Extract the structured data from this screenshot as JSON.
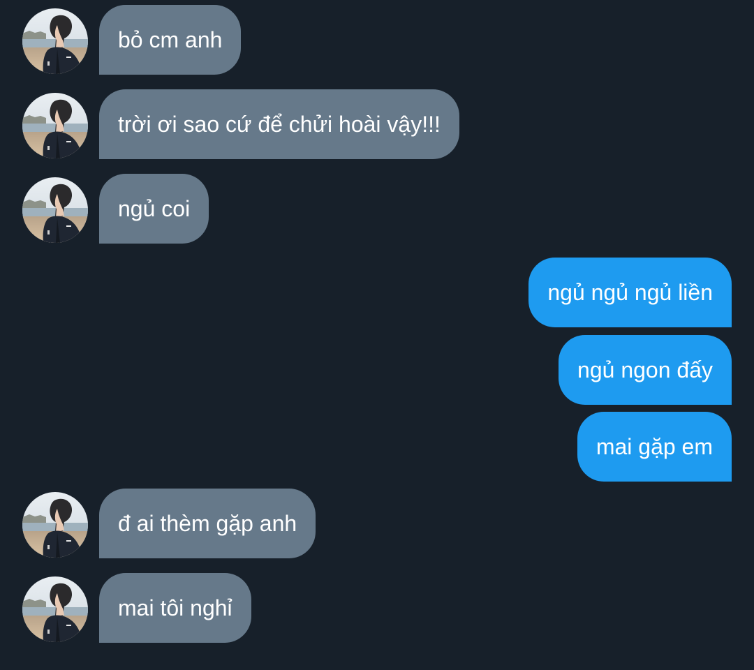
{
  "messages": [
    {
      "direction": "incoming",
      "text": "bỏ cm anh"
    },
    {
      "direction": "incoming",
      "text": "trời ơi sao cứ để chửi hoài vậy!!!"
    },
    {
      "direction": "incoming",
      "text": "ngủ coi"
    },
    {
      "direction": "outgoing",
      "text": "ngủ ngủ ngủ liền"
    },
    {
      "direction": "outgoing",
      "text": "ngủ ngon đấy"
    },
    {
      "direction": "outgoing",
      "text": "mai gặp em"
    },
    {
      "direction": "incoming",
      "text": "đ ai thèm gặp anh"
    },
    {
      "direction": "incoming",
      "text": "mai tôi nghỉ"
    }
  ],
  "colors": {
    "background": "#17202a",
    "incoming_bubble": "#66798a",
    "outgoing_bubble": "#1e9bf0",
    "text": "#ffffff"
  },
  "icons": {
    "avatar": "user-avatar-photo"
  }
}
